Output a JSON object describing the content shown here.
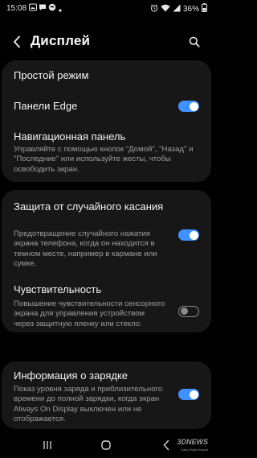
{
  "status_bar": {
    "time": "15:08",
    "battery": "36%"
  },
  "header": {
    "title": "Дисплей"
  },
  "card1": {
    "easy_mode": "Простой режим",
    "edge_panels": "Панели Edge",
    "edge_panels_on": true,
    "nav_bar_title": "Навигационная панель",
    "nav_bar_desc": "Управляйте с помощью кнопок \"Домой\", \"Назад\" и \"Последние\" или используйте жесты, чтобы освободить экран."
  },
  "card2": {
    "accidental_touch_title": "Защита от случайного касания",
    "accidental_touch_desc": "Предотвращение случайного нажатия экрана телефона, когда он находится в темном месте, например в кармане или сумке.",
    "accidental_touch_on": true,
    "sensitivity_title": "Чувствительность",
    "sensitivity_desc": "Повышение чувствительности сенсорного экрана для управления устройством через защитную пленку или стекло.",
    "sensitivity_on": false
  },
  "card3": {
    "charging_title": "Информация о зарядке",
    "charging_desc": "Показ уровня заряда и приблизительного времени до полной зарядки, когда экран Always On Display выключен или не отображается.",
    "charging_on": true
  },
  "watermark": {
    "brand": "3DNEWS",
    "tagline": "Daily Digital Digest"
  },
  "colors": {
    "accent": "#3e91ff",
    "card_bg": "#171717",
    "background": "#010101"
  }
}
